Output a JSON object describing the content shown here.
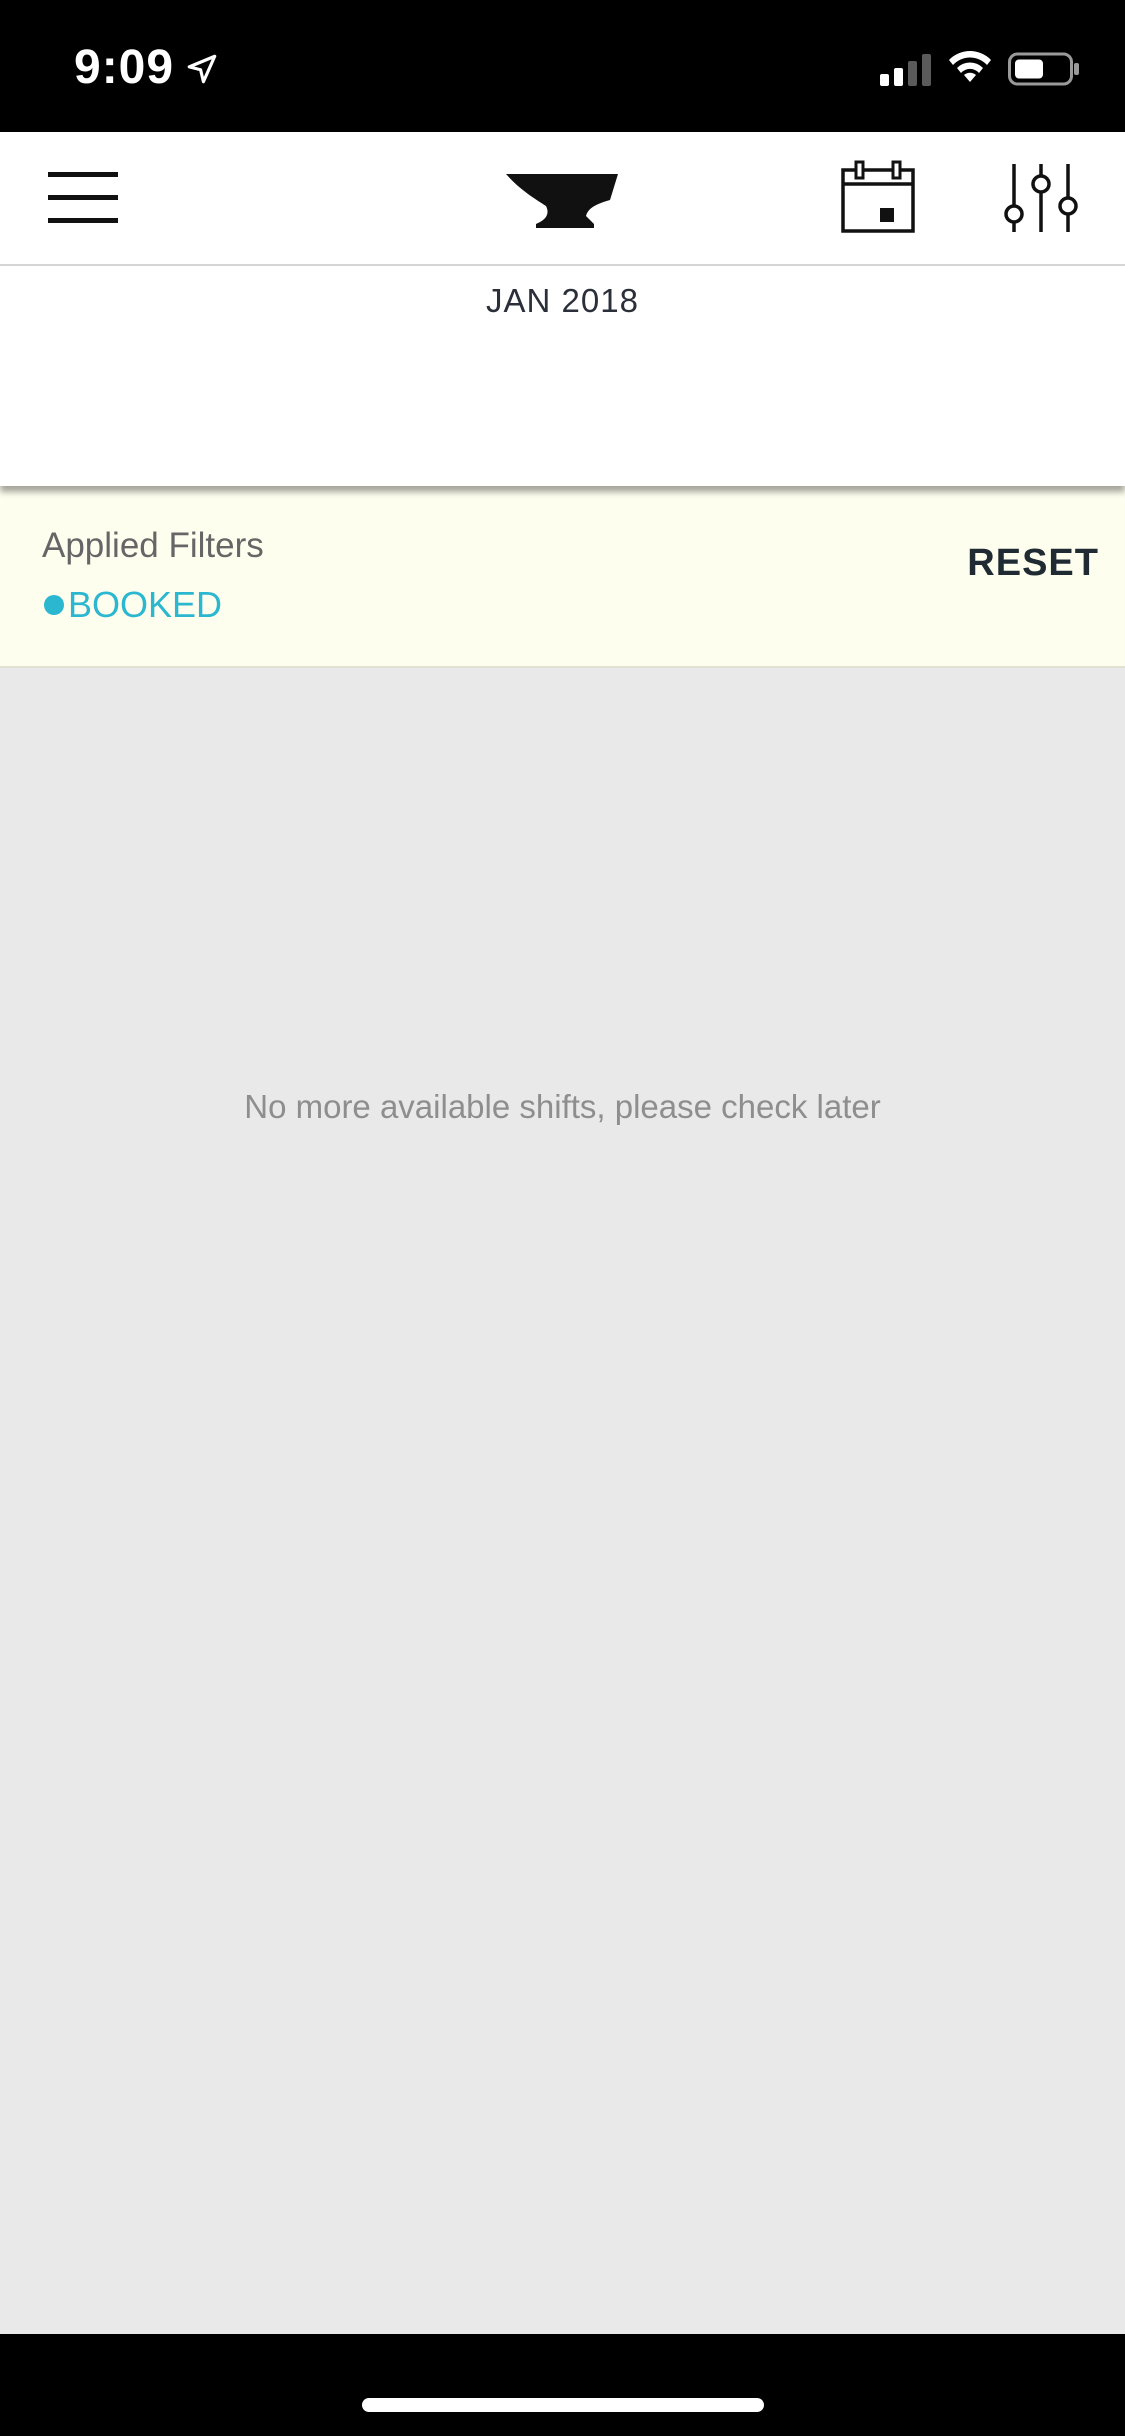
{
  "status_bar": {
    "time": "9:09",
    "icons": [
      "location-arrow-icon",
      "cellular-signal-icon",
      "wifi-icon",
      "battery-icon"
    ]
  },
  "nav_bar": {
    "icons": [
      "hamburger-menu-icon",
      "anvil-logo",
      "calendar-icon",
      "filter-sliders-icon"
    ]
  },
  "calendar_header": {
    "month": "JAN 2018"
  },
  "filters": {
    "title": "Applied Filters",
    "active": [
      "BOOKED"
    ],
    "reset_label": "RESET",
    "accent_color": "#2bb7cf",
    "background_color": "#fefeef"
  },
  "content": {
    "empty_message": "No more available shifts, please check later",
    "background_color": "#e9e9e9"
  }
}
